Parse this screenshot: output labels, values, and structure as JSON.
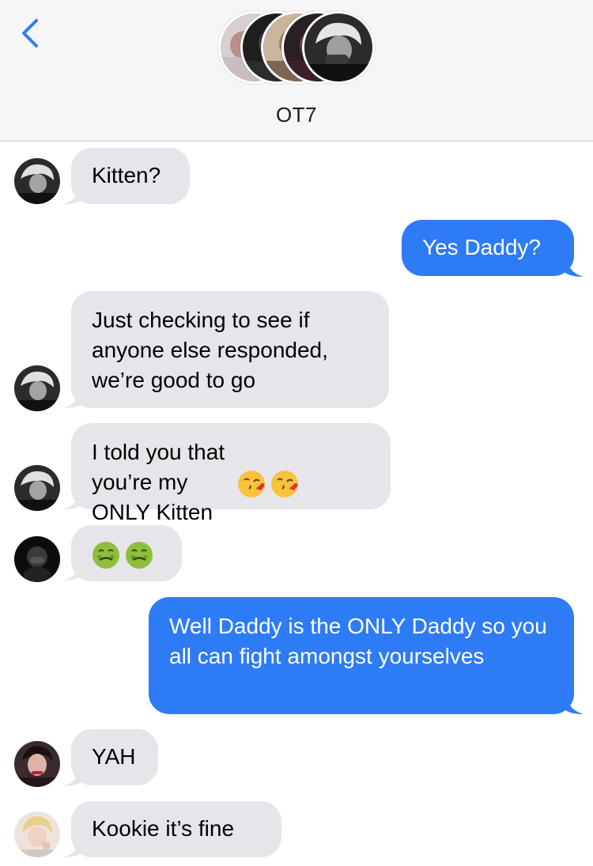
{
  "header": {
    "group_name": "OT7",
    "back_icon": "chevron-left-icon",
    "accent": "#2f7cf6"
  },
  "colors": {
    "incoming_bubble": "#e5e5ea",
    "outgoing_bubble": "#2e7bf6",
    "header_bg": "#f6f6f7"
  },
  "messages": [
    {
      "direction": "incoming",
      "text": "Kitten?"
    },
    {
      "direction": "outgoing",
      "text": "Yes Daddy?"
    },
    {
      "direction": "incoming",
      "text": "Just checking to see if anyone else responded, we’re good to go"
    },
    {
      "direction": "incoming",
      "text": "I told you that you’re my ONLY Kitten",
      "emojis": [
        "kissing-heart-emoji",
        "kissing-heart-emoji"
      ]
    },
    {
      "direction": "incoming",
      "text": "",
      "emojis": [
        "nauseated-face-emoji",
        "nauseated-face-emoji"
      ]
    },
    {
      "direction": "outgoing",
      "text": "Well Daddy is the ONLY Daddy so you all can fight amongst yourselves"
    },
    {
      "direction": "incoming",
      "text": "YAH"
    },
    {
      "direction": "incoming",
      "text": "Kookie it’s fine"
    }
  ]
}
